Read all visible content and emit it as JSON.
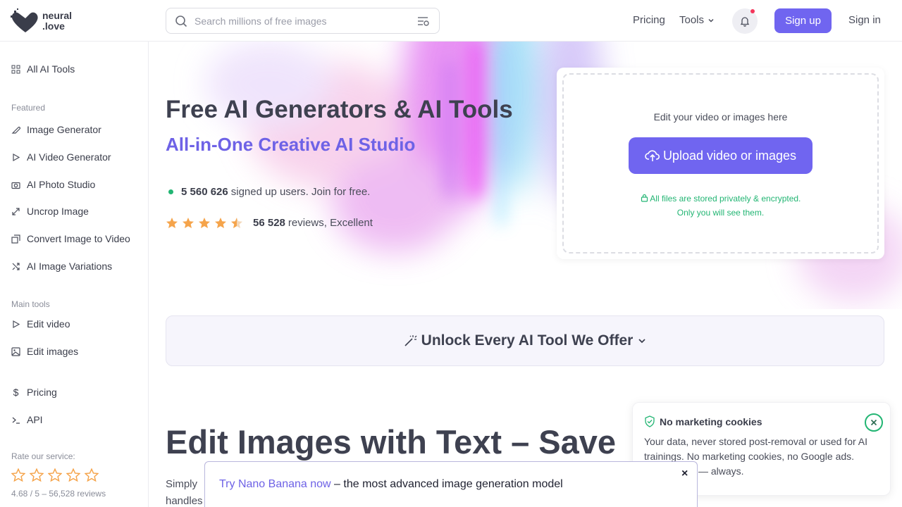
{
  "header": {
    "logo_line1": "neural",
    "logo_line2": ".love",
    "search_placeholder": "Search millions of free images",
    "pricing": "Pricing",
    "tools": "Tools",
    "signup": "Sign up",
    "signin": "Sign in"
  },
  "sidebar": {
    "all_tools": "All AI Tools",
    "featured_label": "Featured",
    "featured": [
      "Image Generator",
      "AI Video Generator",
      "AI Photo Studio",
      "Uncrop Image",
      "Convert Image to Video",
      "AI Image Variations"
    ],
    "main_label": "Main tools",
    "main": [
      "Edit video",
      "Edit images"
    ],
    "pricing": "Pricing",
    "api": "API",
    "rate_label": "Rate our service:",
    "rating_max": 5,
    "rate_score": "4.68 / 5 – 56,528 reviews"
  },
  "hero": {
    "title": "Free AI Generators & AI Tools",
    "subtitle": "All-in-One Creative AI Studio",
    "users_count": "5 560 626",
    "users_text": "signed up users. Join for free.",
    "reviews_count": "56 528",
    "reviews_text": "reviews, Excellent",
    "star_rating": 4.5
  },
  "upload": {
    "hint": "Edit your video or images here",
    "button": "Upload video or images",
    "note_line1": "All files are stored privately & encrypted.",
    "note_line2": "Only you will see them."
  },
  "unlock": {
    "label": "Unlock Every AI Tool We Offer"
  },
  "section": {
    "title": "Edit Images with Text – Save",
    "body_line1": "Simply",
    "body_line2": "handles"
  },
  "cookie": {
    "title": "No marketing cookies",
    "text": "Your data, never stored post-removal or used for AI trainings. No marketing cookies, no Google ads. Privacy-first — always."
  },
  "banner": {
    "link": "Try Nano Banana now",
    "text": " – the most advanced image generation model",
    "close": "×"
  },
  "colors": {
    "accent": "#7065f0",
    "green": "#22b573",
    "star": "#f5a44b"
  }
}
